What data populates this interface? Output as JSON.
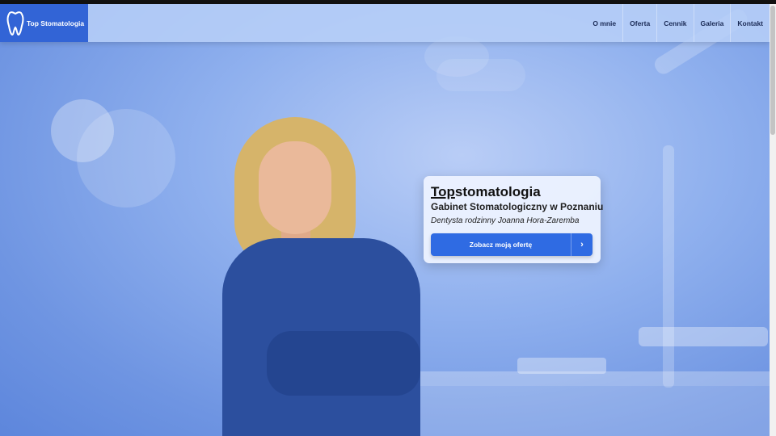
{
  "nav": {
    "logo_text": "Top Stomatologia",
    "links": [
      "O mnie",
      "Oferta",
      "Cennik",
      "Galeria",
      "Kontakt"
    ]
  },
  "hero_card": {
    "title_underlined": "Top",
    "title_rest": "stomatologia",
    "subtitle": "Gabinet Stomatologiczny w Poznaniu",
    "dentist": "Dentysta rodzinny Joanna Hora-Zaremba",
    "cta_label": "Zobacz moją ofertę",
    "cta_arrow": "›"
  },
  "colors": {
    "logo_bg": "#3264d6",
    "cta_bg": "#2f6be3",
    "hero_bg": "#8fb0ee"
  },
  "icons": {
    "logo": "tooth-icon",
    "cta": "chevron-right-icon"
  }
}
